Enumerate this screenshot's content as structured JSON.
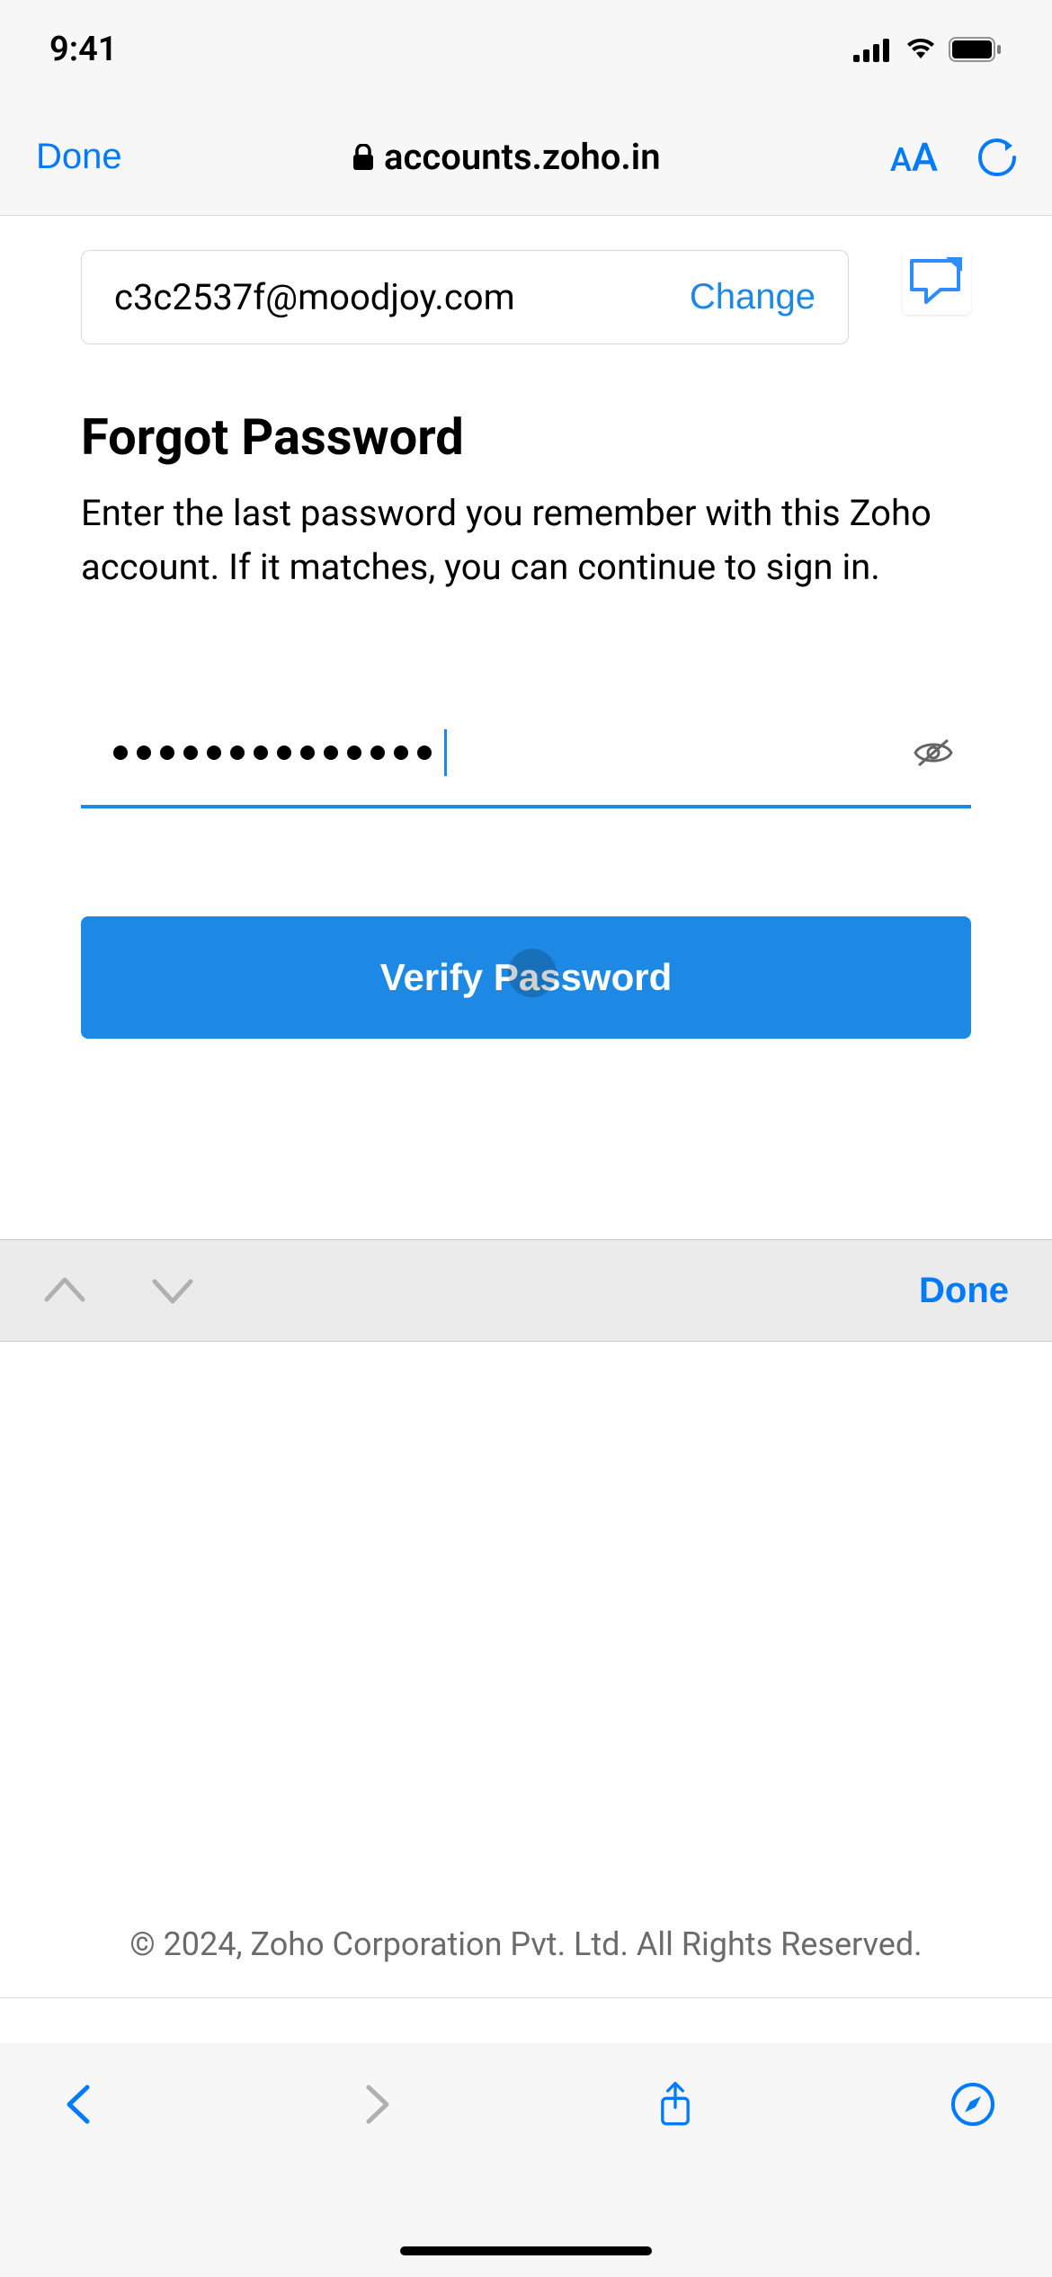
{
  "status_bar": {
    "time": "9:41"
  },
  "browser_nav": {
    "done_label": "Done",
    "url": "accounts.zoho.in"
  },
  "email_box": {
    "email": "c3c2537f@moodjoy.com",
    "change_label": "Change"
  },
  "page": {
    "title": "Forgot Password",
    "description": "Enter the last password you remember with this Zoho account. If it matches, you can continue to sign in."
  },
  "password": {
    "dot_count": 14
  },
  "verify_button": {
    "label": "Verify Password"
  },
  "keyboard_accessory": {
    "done_label": "Done"
  },
  "footer": {
    "copyright": "© 2024, Zoho Corporation Pvt. Ltd. All Rights Reserved."
  }
}
